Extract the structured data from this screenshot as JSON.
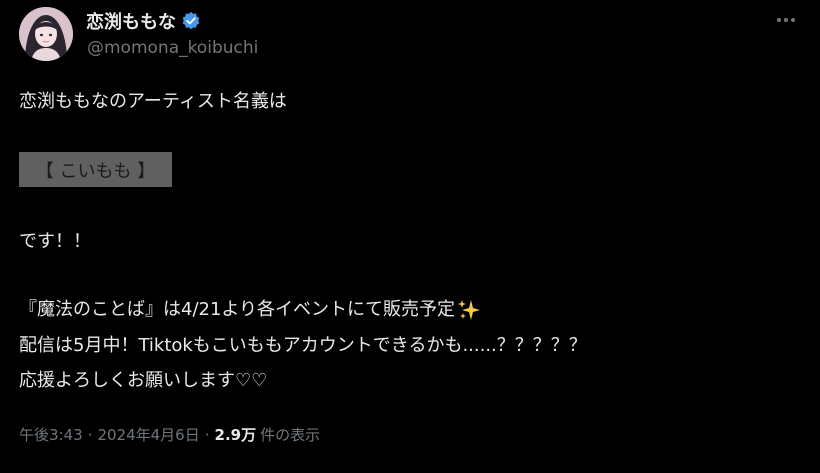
{
  "author": {
    "display_name": "恋渕ももな",
    "handle": "@momona_koibuchi",
    "verified_color": "#4a99e9"
  },
  "more_icon": "more-horizontal-icon",
  "post": {
    "line1": "恋渕ももなのアーティスト名義は",
    "artist_name_box": "【 こいもも 】",
    "line3": "です！！",
    "line4": "『魔法のことば』は4/21より各イベントにて販売予定",
    "line4_emoji": "sparkles-icon",
    "line5": "配信は5月中！Tiktokもこいももアカウントできるかも......？？？？？",
    "line6": "応援よろしくお願いします♡♡"
  },
  "meta": {
    "time": "午後3:43",
    "separator": "·",
    "date": "2024年4月6日",
    "views_count": "2.9万",
    "views_label": "件の表示"
  },
  "colors": {
    "background": "#000000",
    "primary_text": "#e7e9ea",
    "secondary_text": "#71767b",
    "name_box_bg": "#606060"
  }
}
